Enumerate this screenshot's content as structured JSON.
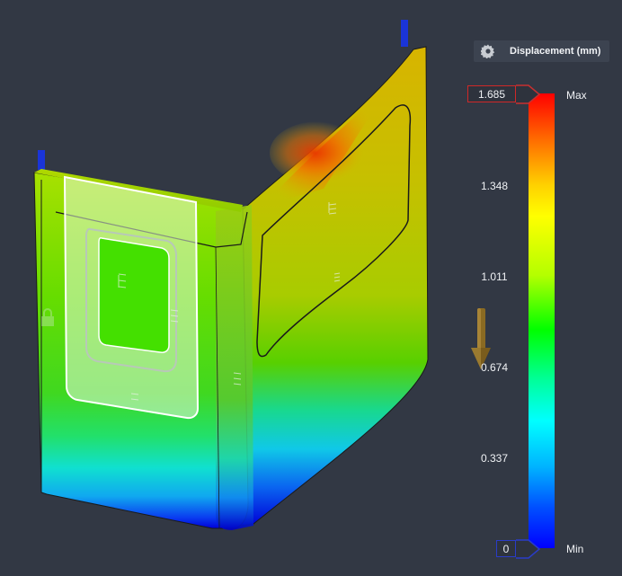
{
  "legend": {
    "title": "Displacement (mm)",
    "max_label": "Max",
    "min_label": "Min",
    "max_value": "1.685",
    "min_value": "0",
    "ticks": [
      "1.348",
      "1.011",
      "0.674",
      "0.337"
    ],
    "colors": [
      "#ff0000",
      "#ffff00",
      "#00ff00",
      "#00ffff",
      "#0000ff"
    ]
  },
  "icons": {
    "settings": "gear-icon",
    "load_direction": "arrow-down-icon"
  }
}
